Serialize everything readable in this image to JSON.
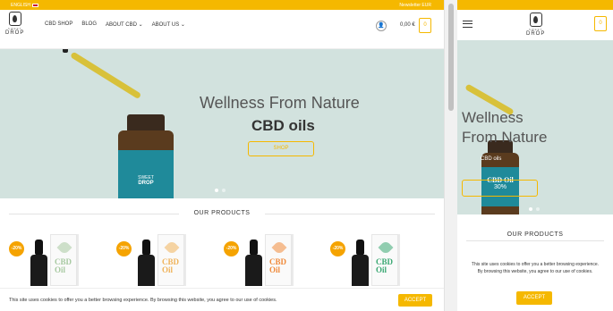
{
  "desktop": {
    "topbar": {
      "language": "ENGLISH",
      "right_text": "Newsletter EUR"
    },
    "logo": {
      "tagline": "SWEET",
      "name": "DROP"
    },
    "menu": [
      "CBD SHOP",
      "BLOG",
      "ABOUT CBD",
      "ABOUT US"
    ],
    "cart_total": "0,00 €",
    "cart_count": "0",
    "hero": {
      "title": "Wellness From Nature",
      "subtitle": "CBD oils",
      "button": "SHOP",
      "label_brand": "SWEET",
      "label_name": "DROP"
    },
    "products_title": "OUR PRODUCTS",
    "products": [
      {
        "badge": "-20%",
        "box_text": "CBD Oil",
        "accent": "#a7c9a1"
      },
      {
        "badge": "-20%",
        "box_text": "CBD Oil",
        "accent": "#f0b35a"
      },
      {
        "badge": "-20%",
        "box_text": "CBD Oil",
        "accent": "#f08a3a"
      },
      {
        "badge": "-20%",
        "box_text": "CBD Oil",
        "accent": "#3aa873"
      }
    ],
    "cookie": {
      "message": "This site uses cookies to offer you a better browsing experience. By browsing this website, you agree to our use of cookies.",
      "accept": "ACCEPT"
    }
  },
  "mobile": {
    "logo": {
      "tagline": "SWEET",
      "name": "DROP"
    },
    "cart_count": "0",
    "hero": {
      "title_line1": "Wellness",
      "title_line2": "From Nature",
      "subtitle": "CBD oils",
      "bottle_text": "CBD Oil",
      "bottle_strength": "30%"
    },
    "products_title": "OUR PRODUCTS",
    "cookie": {
      "message": "This site uses cookies to offer you a better browsing experience. By browsing this website, you agree to our use of cookies.",
      "accept": "ACCEPT"
    }
  },
  "colors": {
    "accent": "#f5b800",
    "hero_bg": "#d2e2de",
    "badge": "#f5a300",
    "label_teal": "#1f8a9a"
  }
}
